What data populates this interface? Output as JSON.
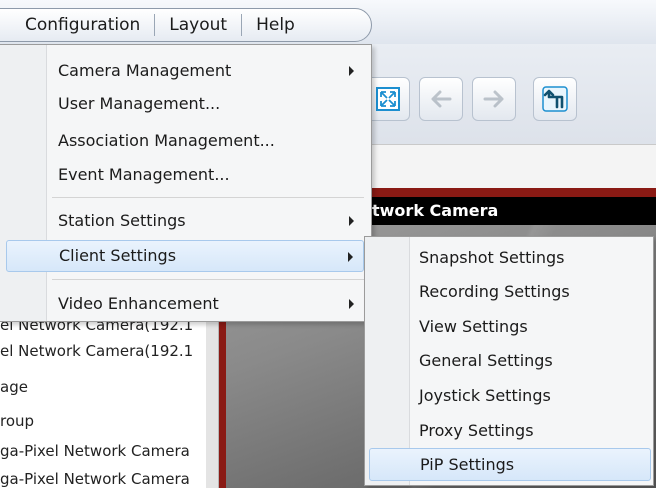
{
  "menubar": {
    "items": [
      "Configuration",
      "Layout",
      "Help"
    ]
  },
  "dropdown": {
    "items": [
      {
        "label": "Camera Management",
        "has_submenu": true
      },
      {
        "label": "User Management...",
        "has_submenu": false
      },
      {
        "label": "Association Management...",
        "has_submenu": false
      },
      {
        "label": "Event Management...",
        "has_submenu": false
      },
      {
        "label": "Station Settings",
        "has_submenu": true
      },
      {
        "label": "Client Settings",
        "has_submenu": true,
        "highlighted": true
      },
      {
        "label": "Video Enhancement",
        "has_submenu": true
      }
    ]
  },
  "submenu": {
    "items": [
      {
        "label": "Snapshot Settings"
      },
      {
        "label": "Recording Settings"
      },
      {
        "label": "View Settings"
      },
      {
        "label": "General Settings"
      },
      {
        "label": "Joystick Settings"
      },
      {
        "label": "Proxy Settings"
      },
      {
        "label": "PiP Settings",
        "highlighted": true
      }
    ]
  },
  "toolbar": {
    "buttons": [
      {
        "icon": "fullscreen-icon",
        "enabled": true
      },
      {
        "icon": "back-arrow-icon",
        "enabled": false
      },
      {
        "icon": "forward-arrow-icon",
        "enabled": false
      },
      {
        "icon": "return-icon",
        "enabled": true
      }
    ]
  },
  "video": {
    "title": "twork Camera"
  },
  "tree": {
    "items": [
      "el Network Camera(192.1",
      "el Network Camera(192.1",
      "age",
      "roup",
      "ga-Pixel Network Camera",
      "ga-Pixel Network Camera"
    ]
  },
  "colors": {
    "accent_highlight": "#d6e7f9",
    "video_frame": "#8a1a14",
    "toolbar_icon": "#1c8fd0"
  }
}
